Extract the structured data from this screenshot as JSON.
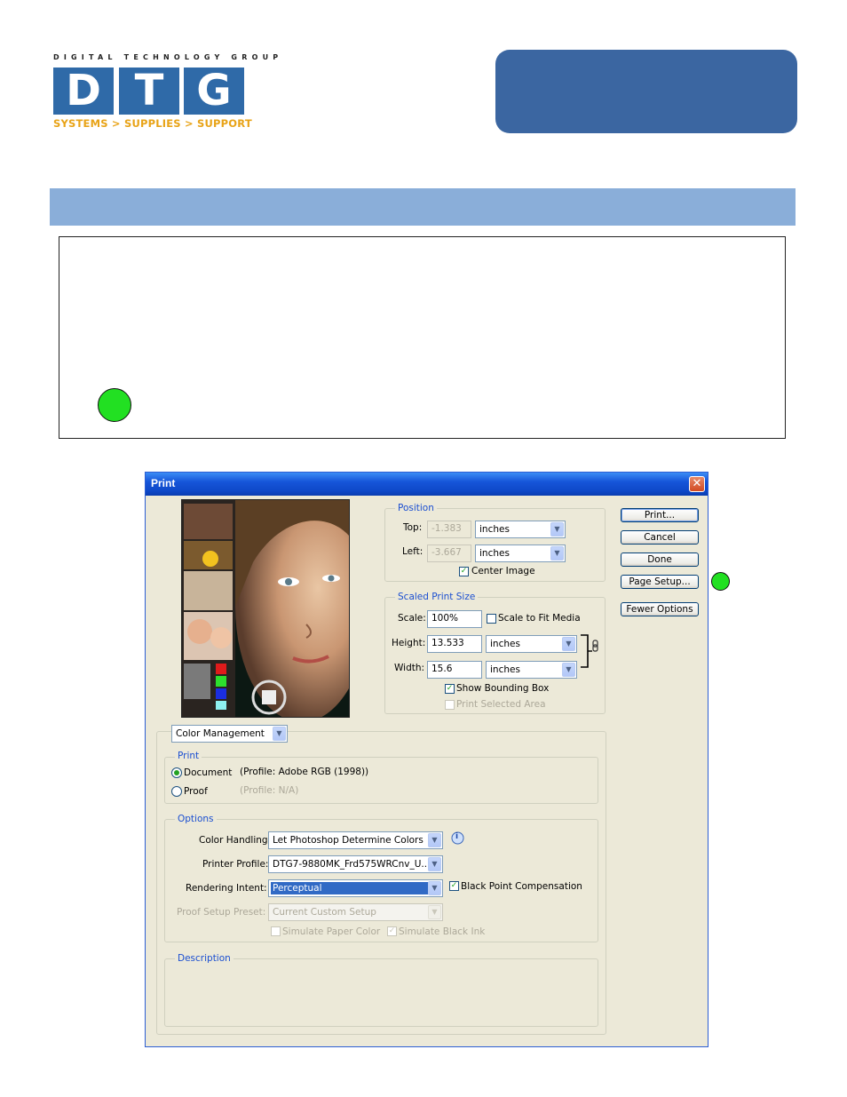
{
  "logo": {
    "top_line": "DIGITAL TECHNOLOGY GROUP",
    "letters": [
      "D",
      "T",
      "G"
    ],
    "tagline": "SYSTEMS > SUPPLIES > SUPPORT"
  },
  "colors": {
    "brand_blue": "#2f6aa8",
    "brand_gold": "#e8a317",
    "pill_blue": "#3b66a1",
    "band_blue": "#8aaed9",
    "marker_green": "#22e022"
  },
  "dialog": {
    "title": "Print",
    "close_glyph": "✕",
    "position": {
      "legend": "Position",
      "top_label": "Top:",
      "top_value": "-1.383",
      "top_unit": "inches",
      "left_label": "Left:",
      "left_value": "-3.667",
      "left_unit": "inches",
      "center_image_label": "Center Image",
      "center_image_checked": true
    },
    "scaled": {
      "legend": "Scaled Print Size",
      "scale_label": "Scale:",
      "scale_value": "100%",
      "fit_media_label": "Scale to Fit Media",
      "height_label": "Height:",
      "height_value": "13.533",
      "height_unit": "inches",
      "width_label": "Width:",
      "width_value": "15.6",
      "width_unit": "inches",
      "bounding_box_label": "Show Bounding Box",
      "selected_area_label": "Print Selected Area",
      "link_icon": "chain-link-icon"
    },
    "buttons": {
      "print": "Print...",
      "cancel": "Cancel",
      "done": "Done",
      "page_setup": "Page Setup...",
      "fewer_options": "Fewer Options"
    },
    "mode_select": "Color Management",
    "print_group": {
      "legend": "Print",
      "document_label": "Document",
      "document_profile": "(Profile: Adobe RGB (1998))",
      "proof_label": "Proof",
      "proof_profile": "(Profile: N/A)",
      "selected": "document"
    },
    "options": {
      "legend": "Options",
      "color_handling_label": "Color Handling:",
      "color_handling_value": "Let Photoshop Determine Colors",
      "printer_profile_label": "Printer Profile:",
      "printer_profile_value": "DTG7-9880MK_Frd575WRCnv_U...",
      "rendering_intent_label": "Rendering Intent:",
      "rendering_intent_value": "Perceptual",
      "black_point_label": "Black Point Compensation",
      "proof_preset_label": "Proof Setup Preset:",
      "proof_preset_value": "Current Custom Setup",
      "simulate_paper_label": "Simulate Paper Color",
      "simulate_ink_label": "Simulate Black Ink",
      "info_icon": "i"
    },
    "description": {
      "legend": "Description"
    }
  }
}
